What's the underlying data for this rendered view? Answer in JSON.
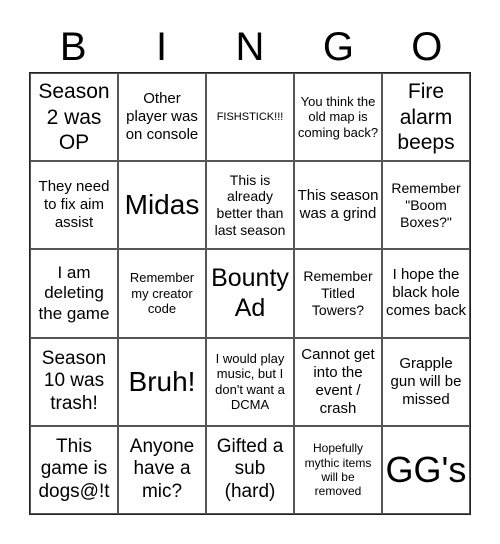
{
  "header": [
    "B",
    "I",
    "N",
    "G",
    "O"
  ],
  "rows": [
    [
      "Season 2 was OP",
      "Other player was on console",
      "FISHSTICK!!!",
      "You think the old map is coming back?",
      "Fire alarm beeps"
    ],
    [
      "They need to fix aim assist",
      "Midas",
      "This is already better than last season",
      "This season was a grind",
      "Remember \"Boom Boxes?\""
    ],
    [
      "I am deleting the game",
      "Remember my creator code",
      "Bounty Ad",
      "Remember Titled Towers?",
      "I hope the black hole comes back"
    ],
    [
      "Season 10 was trash!",
      "Bruh!",
      "I would play music, but I don't want a DCMA",
      "Cannot get into the event / crash",
      "Grapple gun will be missed"
    ],
    [
      "This game is dogs@!t",
      "Anyone have a mic?",
      "Gifted a sub (hard)",
      "Hopefully mythic items will be removed",
      "GG's"
    ]
  ]
}
